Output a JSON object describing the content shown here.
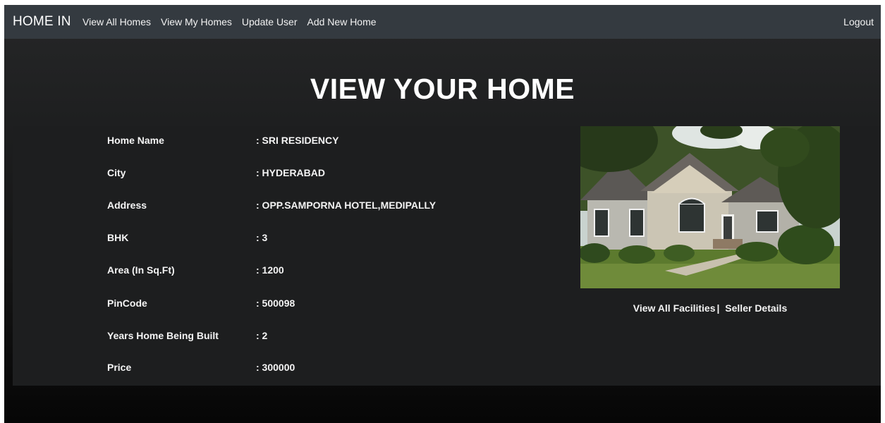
{
  "navbar": {
    "brand": "HOME IN",
    "links": [
      "View All Homes",
      "View My Homes",
      "Update User",
      "Add New Home"
    ],
    "logout": "Logout"
  },
  "main": {
    "title": "VIEW YOUR HOME",
    "details": [
      {
        "label": "Home Name",
        "value": ": SRI RESIDENCY"
      },
      {
        "label": "City",
        "value": ": HYDERABAD"
      },
      {
        "label": "Address",
        "value": ": OPP.SAMPORNA HOTEL,MEDIPALLY"
      },
      {
        "label": "BHK",
        "value": ": 3"
      },
      {
        "label": "Area (In Sq.Ft)",
        "value": ": 1200"
      },
      {
        "label": "PinCode",
        "value": ": 500098"
      },
      {
        "label": "Years Home Being Built",
        "value": ": 2"
      },
      {
        "label": "Price",
        "value": ": 300000"
      }
    ],
    "links": {
      "facilities": "View All Facilities",
      "separator": "|",
      "seller": "Seller Details"
    }
  }
}
